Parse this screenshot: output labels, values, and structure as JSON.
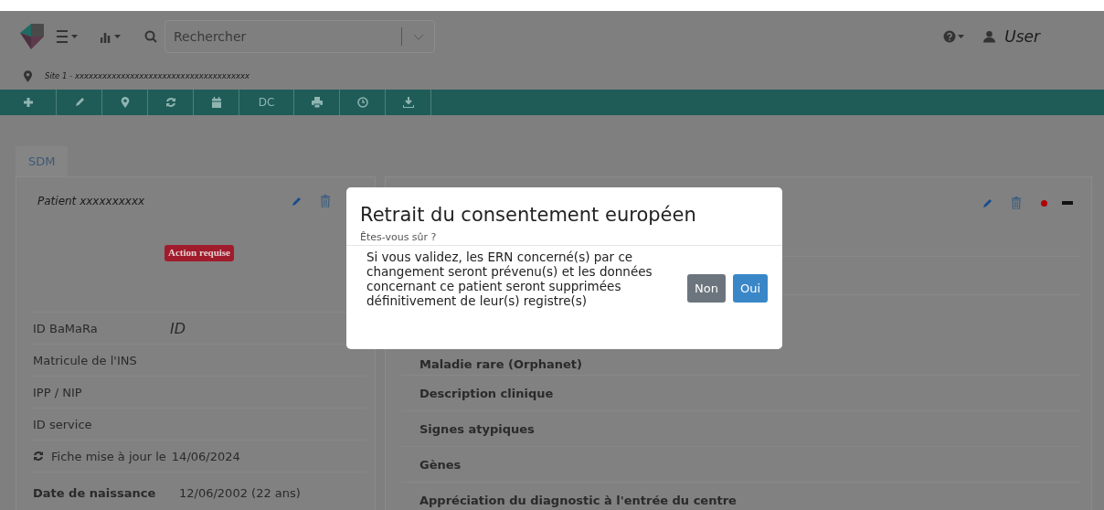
{
  "header": {
    "search": {
      "placeholder": "Rechercher"
    },
    "user": "User"
  },
  "site": "Site 1 - xxxxxxxxxxxxxxxxxxxxxxxxxxxxxxxxxxxxxx",
  "toolbar": [
    {
      "kind": "add"
    },
    {
      "kind": "edit"
    },
    {
      "kind": "location"
    },
    {
      "kind": "refresh"
    },
    {
      "kind": "calendar"
    },
    {
      "kind": "text",
      "label": "DC"
    },
    {
      "kind": "print"
    },
    {
      "kind": "clock"
    },
    {
      "kind": "download"
    }
  ],
  "tabs": [
    {
      "label": "SDM",
      "selected": true
    }
  ],
  "patient": {
    "name": "Patient xxxxxxxxxx",
    "badge": "Action requise",
    "fields": [
      {
        "label": "ID BaMaRa",
        "value": "ID"
      },
      {
        "label": "Matricule de l'INS"
      },
      {
        "label": "IPP / NIP"
      },
      {
        "label": "ID service"
      }
    ],
    "updated": {
      "label": "Fiche mise à jour le",
      "date": "14/06/2024"
    },
    "birth": {
      "label": "Date de naissance",
      "value": "12/06/2002 (22 ans)"
    }
  },
  "diagnosis": {
    "sections": [
      "Maladie rare (Orphanet)",
      "Description clinique",
      "Signes atypiques",
      "Gènes",
      "Appréciation du diagnostic à l'entrée du centre"
    ]
  },
  "dialog": {
    "title": "Retrait du consentement européen",
    "subtitle": "Êtes-vous sûr ?",
    "message": "Si vous validez, les ERN concerné(s) par ce changement seront prévenu(s) et les données concernant ce patient seront supprimées définitivement de leur(s) registre(s)",
    "buttons": [
      {
        "label": "Non",
        "kind": "secondary"
      },
      {
        "label": "Oui",
        "kind": "primary"
      }
    ]
  }
}
